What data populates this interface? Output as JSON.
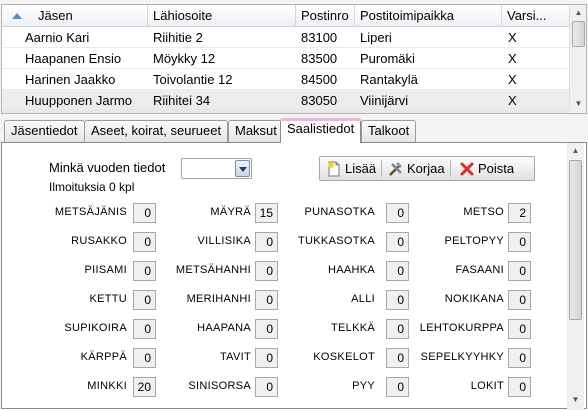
{
  "grid": {
    "columns": [
      "Jäsen",
      "Lähiosoite",
      "Postinro",
      "Postitoimipaikka",
      "Varsi..."
    ],
    "rows": [
      [
        "Aarnio Kari",
        "Riihitie 2",
        "83100",
        "Liperi",
        "X"
      ],
      [
        "Haapanen Ensio",
        "Möykky 12",
        "83500",
        "Puromäki",
        "X"
      ],
      [
        "Harinen Jaakko",
        "Toivolantie 12",
        "84500",
        "Rantakylä",
        "X"
      ],
      [
        "Huupponen Jarmo",
        "Riihitei 34",
        "83050",
        "Viinijärvi",
        "X"
      ]
    ]
  },
  "tabs": [
    "Jäsentiedot",
    "Aseet, koirat, seurueet",
    "Maksut",
    "Saalistiedot",
    "Talkoot"
  ],
  "active_tab": "Saalistiedot",
  "panel": {
    "year_label": "Minkä vuoden tiedot",
    "year_value": "",
    "reports_label": "Ilmoituksia 0 kpl",
    "toolbar": {
      "add": "Lisää",
      "edit": "Korjaa",
      "delete": "Poista"
    },
    "columns": [
      [
        {
          "label": "METSÄJÄNIS",
          "value": "0"
        },
        {
          "label": "RUSAKKO",
          "value": "0"
        },
        {
          "label": "PIISAMI",
          "value": "0"
        },
        {
          "label": "KETTU",
          "value": "0"
        },
        {
          "label": "SUPIKOIRA",
          "value": "0"
        },
        {
          "label": "KÄRPPÄ",
          "value": "0"
        },
        {
          "label": "MINKKI",
          "value": "20"
        }
      ],
      [
        {
          "label": "MÄYRÄ",
          "value": "15"
        },
        {
          "label": "VILLISIKA",
          "value": "0"
        },
        {
          "label": "METSÄHANHI",
          "value": "0"
        },
        {
          "label": "MERIHANHI",
          "value": "0"
        },
        {
          "label": "HAAPANA",
          "value": "0"
        },
        {
          "label": "TAVIT",
          "value": "0"
        },
        {
          "label": "SINISORSA",
          "value": "0"
        }
      ],
      [
        {
          "label": "PUNASOTKA",
          "value": "0"
        },
        {
          "label": "TUKKASOTKA",
          "value": "0"
        },
        {
          "label": "HAAHKA",
          "value": "0"
        },
        {
          "label": "ALLI",
          "value": "0"
        },
        {
          "label": "TELKKÄ",
          "value": "0"
        },
        {
          "label": "KOSKELOT",
          "value": "0"
        },
        {
          "label": "PYY",
          "value": "0"
        }
      ],
      [
        {
          "label": "METSO",
          "value": "2"
        },
        {
          "label": "PELTOPYY",
          "value": "0"
        },
        {
          "label": "FASAANI",
          "value": "0"
        },
        {
          "label": "NOKIKANA",
          "value": "0"
        },
        {
          "label": "LEHTOKURPPA",
          "value": "0"
        },
        {
          "label": "SEPELKYYHKY",
          "value": "0"
        },
        {
          "label": "LOKIT",
          "value": "0"
        }
      ]
    ]
  },
  "icons": {
    "sort": "sort-ascending-icon",
    "add": "document-add-icon",
    "edit": "tools-edit-icon",
    "delete": "red-x-delete-icon"
  }
}
